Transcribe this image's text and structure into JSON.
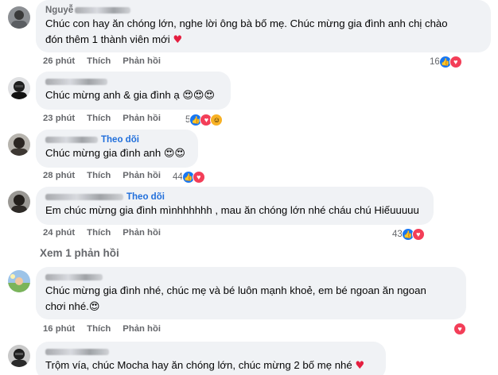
{
  "comments": [
    {
      "name": "Nguyễ",
      "follow": "",
      "text": "Chúc con hay ăn chóng lớn, nghe lời ông bà bố mẹ. Chúc mừng gia đình anh chị chào\nđón thêm 1 thành viên mới",
      "trail": "♥",
      "time": "26 phút",
      "like": "Thích",
      "reply": "Phản hồi",
      "count": "16",
      "reactions": [
        "like",
        "love"
      ]
    },
    {
      "name": "",
      "follow": "",
      "text": "Chúc mừng anh & gia đình ạ",
      "trail": "😍😍😍",
      "time": "23 phút",
      "like": "Thích",
      "reply": "Phản hồi",
      "count": "5",
      "reactions": [
        "like",
        "love",
        "care"
      ]
    },
    {
      "name": "",
      "follow": "Theo dõi",
      "text": "Chúc mừng gia đình anh",
      "trail": "😍😍",
      "time": "28 phút",
      "like": "Thích",
      "reply": "Phản hồi",
      "count": "44",
      "reactions": [
        "like",
        "love"
      ]
    },
    {
      "name": "",
      "follow": "Theo dõi",
      "text": "Em chúc mừng gia đình mìnhhhhhh , mau ăn chóng lớn nhé cháu chú Hiếuuuuu",
      "trail": "",
      "time": "24 phút",
      "like": "Thích",
      "reply": "Phản hồi",
      "count": "43",
      "reactions": [
        "like",
        "love"
      ]
    },
    {
      "name": "",
      "follow": "",
      "text": "Chúc mừng gia đình nhé, chúc mẹ và bé luôn mạnh khoẻ, em bé ngoan ăn ngoan\nchơi nhé.",
      "trail": "😍",
      "time": "16 phút",
      "like": "Thích",
      "reply": "Phản hồi",
      "count": "",
      "reactions": [
        "love"
      ]
    },
    {
      "name": "",
      "follow": "",
      "text": "Trộm vía, chúc Mocha hay ăn chóng lớn, chúc mừng 2 bố mẹ nhé",
      "trail": "♥",
      "time": "",
      "like": "",
      "reply": "",
      "count": "",
      "reactions": []
    }
  ],
  "view_replies": "Xem 1 phản hồi",
  "colors": {
    "bubble": "#f0f2f5",
    "link": "#216fdb",
    "meta": "#65676b",
    "like": "#1877f2",
    "love": "#f33e58"
  },
  "icons": {
    "like": "thumbs-up-icon",
    "love": "heart-icon",
    "care": "care-icon"
  }
}
